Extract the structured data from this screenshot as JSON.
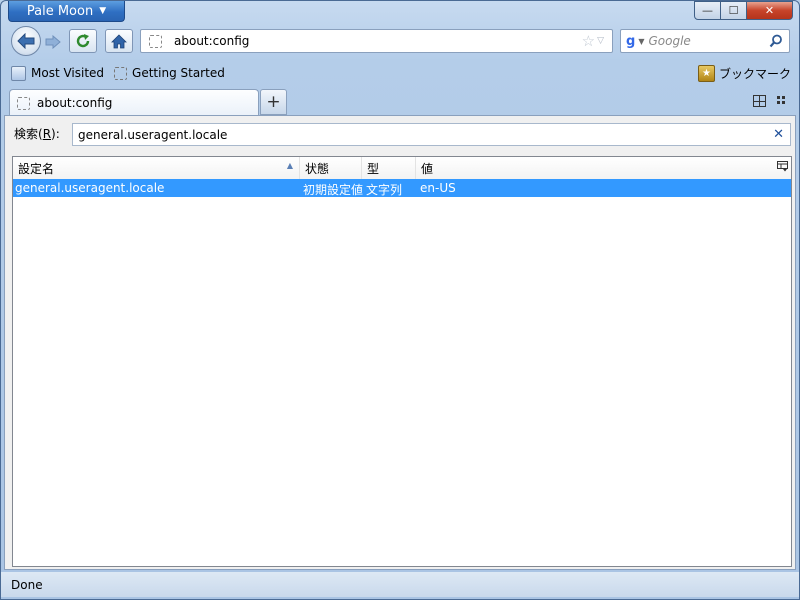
{
  "app": {
    "menu_button_label": "Pale Moon",
    "caption": {
      "minimize": "—",
      "maximize": "☐",
      "close": "✕"
    }
  },
  "navbar": {
    "url": "about:config",
    "search_placeholder": "Google",
    "icons": [
      "back-arrow-icon",
      "forward-arrow-icon",
      "reload-icon",
      "home-icon",
      "star-icon",
      "search-icon"
    ]
  },
  "bookmarks": {
    "items": [
      {
        "label": "Most Visited"
      },
      {
        "label": "Getting Started"
      }
    ],
    "menu_label": "ブックマーク"
  },
  "tabs": [
    {
      "label": "about:config",
      "selected": true
    }
  ],
  "config": {
    "search_label_prefix": "検索(",
    "search_label_key": "R",
    "search_label_suffix": "):",
    "filter_value": "general.useragent.locale",
    "columns": {
      "name": "設定名",
      "status": "状態",
      "type": "型",
      "value": "値"
    },
    "rows": [
      {
        "name": "general.useragent.locale",
        "status": "初期設定値",
        "type": "文字列",
        "value": "en-US"
      }
    ]
  },
  "statusbar": {
    "text": "Done"
  },
  "colors": {
    "selection": "#3399ff",
    "accent": "#2f6fc2"
  }
}
